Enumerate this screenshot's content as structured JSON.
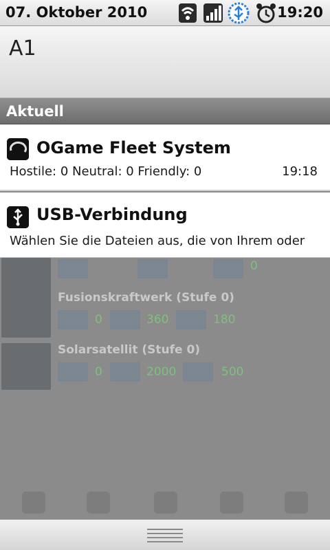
{
  "statusbar": {
    "date": "07. Oktober 2010",
    "time": "19:20",
    "icons": [
      "wifi-icon",
      "signal-icon",
      "usb-debug-icon",
      "alarm-icon"
    ]
  },
  "carrier": {
    "label": "A1"
  },
  "section": {
    "label": "Aktuell"
  },
  "notifications": [
    {
      "title": "OGame Fleet System",
      "text": "Hostile: 0 Neutral: 0 Friendly: 0",
      "time": "19:18",
      "icon": "ogame-icon"
    },
    {
      "title": "USB-Verbindung",
      "text": "Wählen Sie die Dateien aus, die von Ihrem oder",
      "icon": "usb-icon"
    }
  ],
  "background": {
    "rows": [
      {
        "title": "",
        "values": [
          "",
          "",
          "0"
        ]
      },
      {
        "title": "Fusionskraftwerk (Stufe 0)",
        "values": [
          "0",
          "360",
          "180"
        ]
      },
      {
        "title": "Solarsatellit (Stufe 0)",
        "values": [
          "0",
          "2000",
          "500"
        ]
      }
    ]
  },
  "colors": {
    "accent_green": "#7fbf7f",
    "section_bg": "#7a7a7a"
  }
}
